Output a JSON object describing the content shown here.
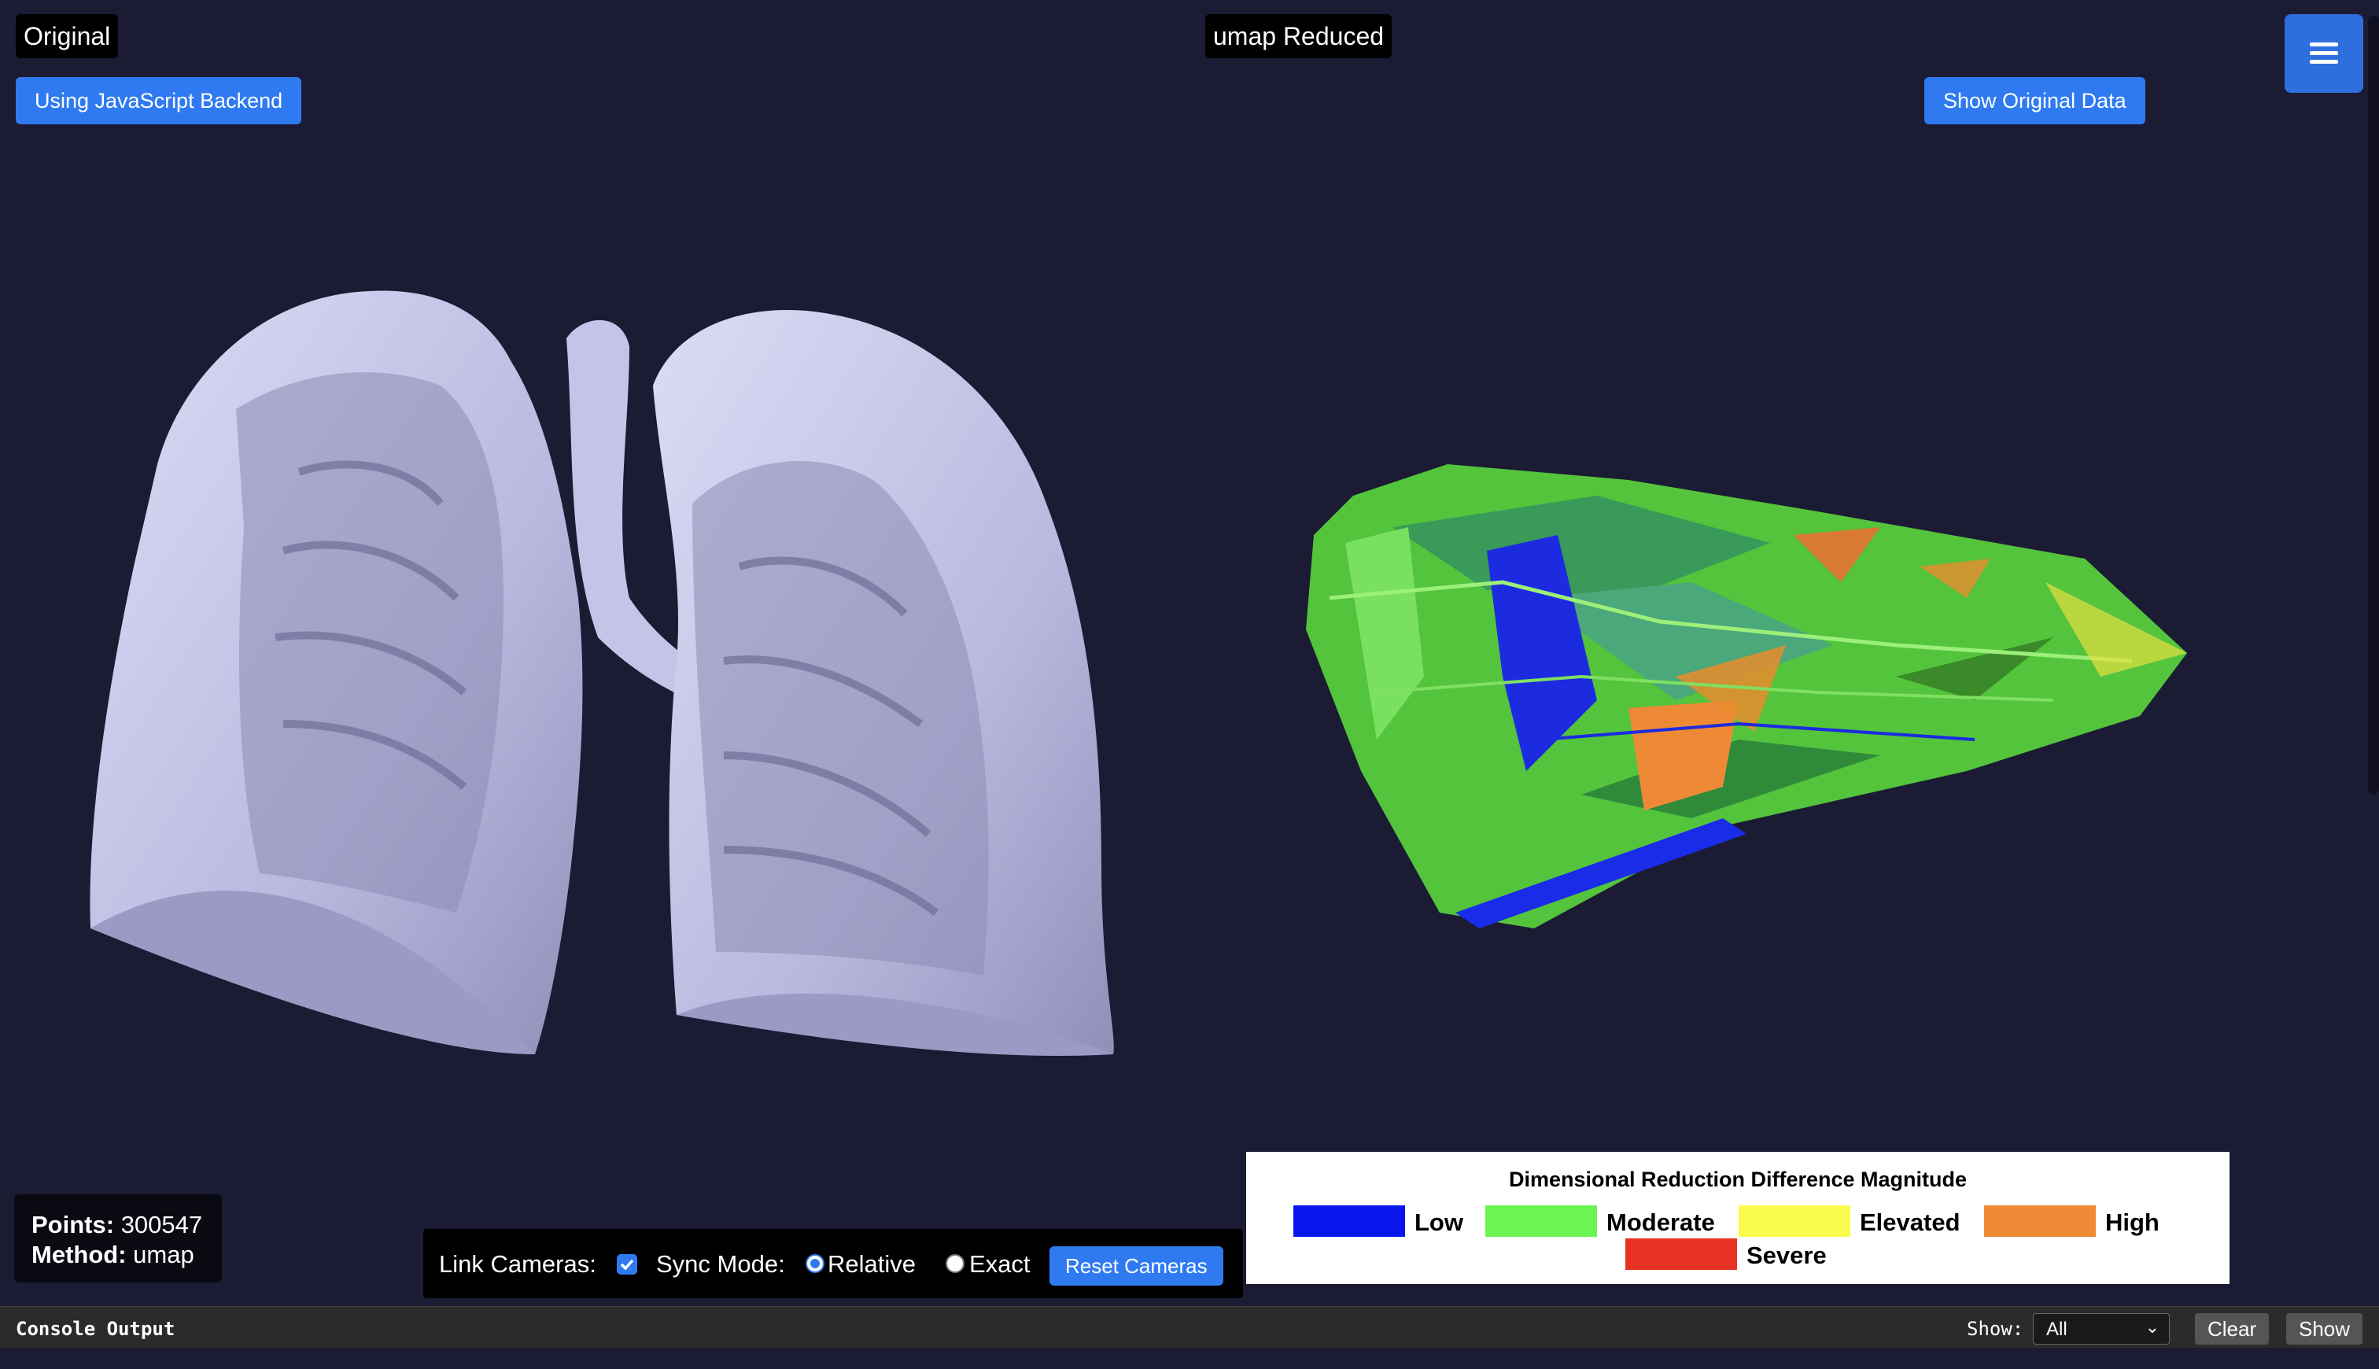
{
  "left_view": {
    "title": "Original",
    "backend_button": "Using JavaScript Backend",
    "info": {
      "points_label": "Points:",
      "points_value": "300547",
      "method_label": "Method:",
      "method_value": "umap"
    }
  },
  "right_view": {
    "title": "umap Reduced",
    "toggle_button": "Show Original Data"
  },
  "camera_controls": {
    "link_label": "Link Cameras:",
    "link_checked": true,
    "sync_label": "Sync Mode:",
    "relative_label": "Relative",
    "exact_label": "Exact",
    "selected_mode": "Relative",
    "reset_button": "Reset Cameras"
  },
  "legend": {
    "title": "Dimensional Reduction Difference Magnitude",
    "items": [
      {
        "label": "Low",
        "color": "#0a16f0"
      },
      {
        "label": "Moderate",
        "color": "#6cf552"
      },
      {
        "label": "Elevated",
        "color": "#fbfb4e"
      },
      {
        "label": "High",
        "color": "#ee8a36"
      },
      {
        "label": "Severe",
        "color": "#e83223"
      }
    ]
  },
  "console": {
    "title": "Console Output",
    "show_label": "Show:",
    "filter_value": "All",
    "clear_button": "Clear",
    "show_button": "Show"
  },
  "icons": {
    "menu": "hamburger-menu-icon",
    "select": "chevron-down-icon"
  },
  "colors": {
    "background": "#1b1b33",
    "accent": "#2f7af0",
    "mesh": "#c8c8ea"
  }
}
